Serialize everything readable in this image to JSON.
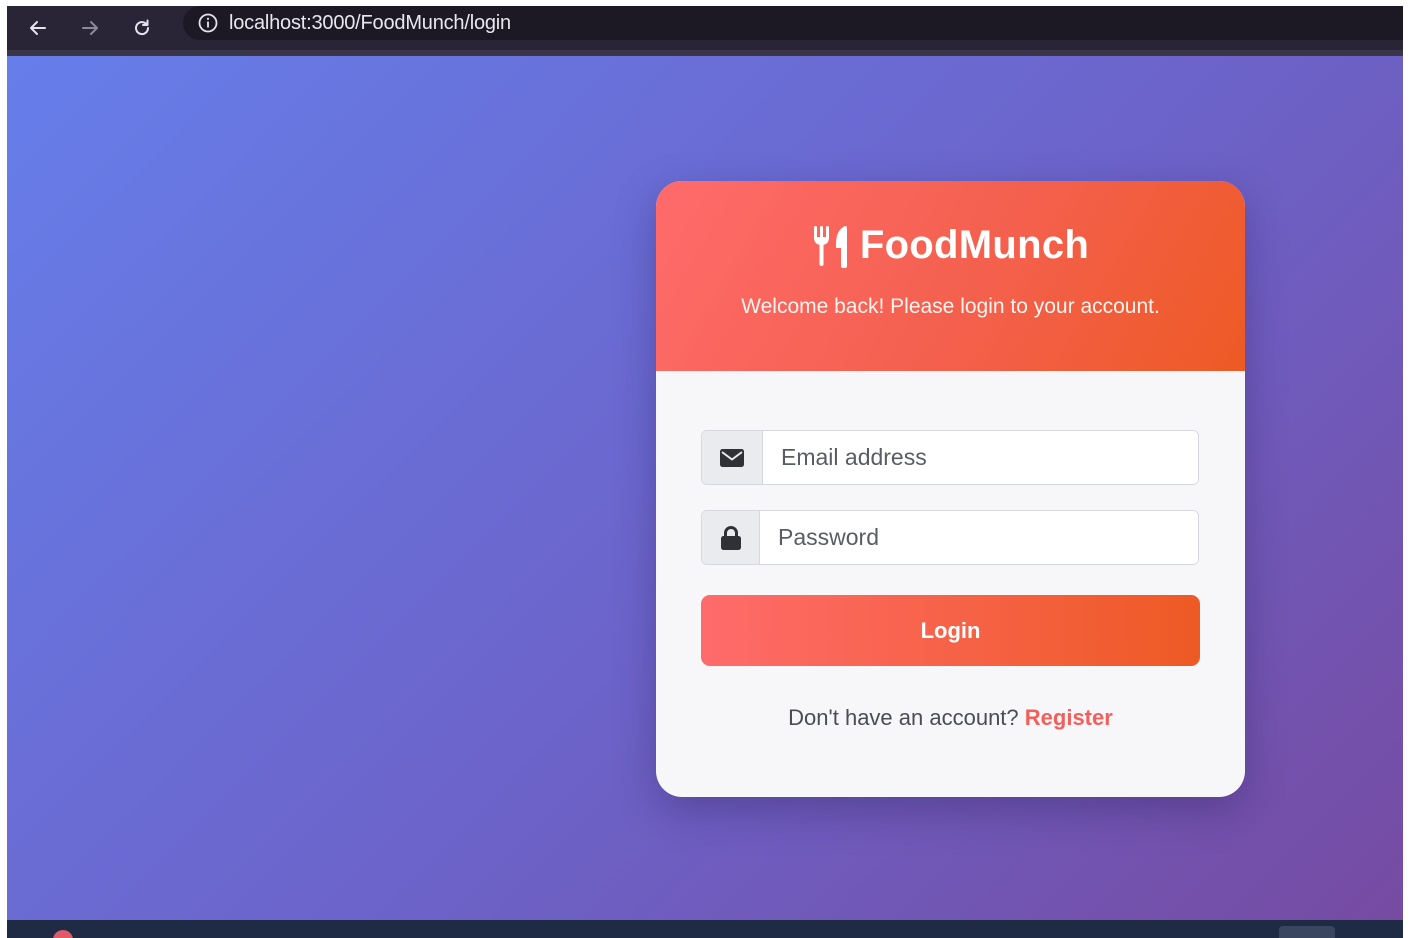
{
  "browser": {
    "url": "localhost:3000/FoodMunch/login",
    "back_icon": "arrow-left-icon",
    "forward_icon": "arrow-right-icon",
    "reload_icon": "reload-icon",
    "info_icon": "info-icon"
  },
  "header": {
    "brand_icon": "utensils-icon",
    "brand_name": "FoodMunch",
    "subtitle": "Welcome back! Please login to your account."
  },
  "form": {
    "email": {
      "icon": "envelope-icon",
      "placeholder": "Email address",
      "value": ""
    },
    "password": {
      "icon": "lock-icon",
      "placeholder": "Password",
      "value": ""
    },
    "login_label": "Login"
  },
  "footer": {
    "prompt": "Don't have an account?",
    "register_label": "Register"
  },
  "colors": {
    "background_start": "#667eea",
    "background_end": "#764ba2",
    "header_start": "#ff6b6b",
    "header_end": "#ee5a24",
    "accent": "#f35f5a"
  }
}
